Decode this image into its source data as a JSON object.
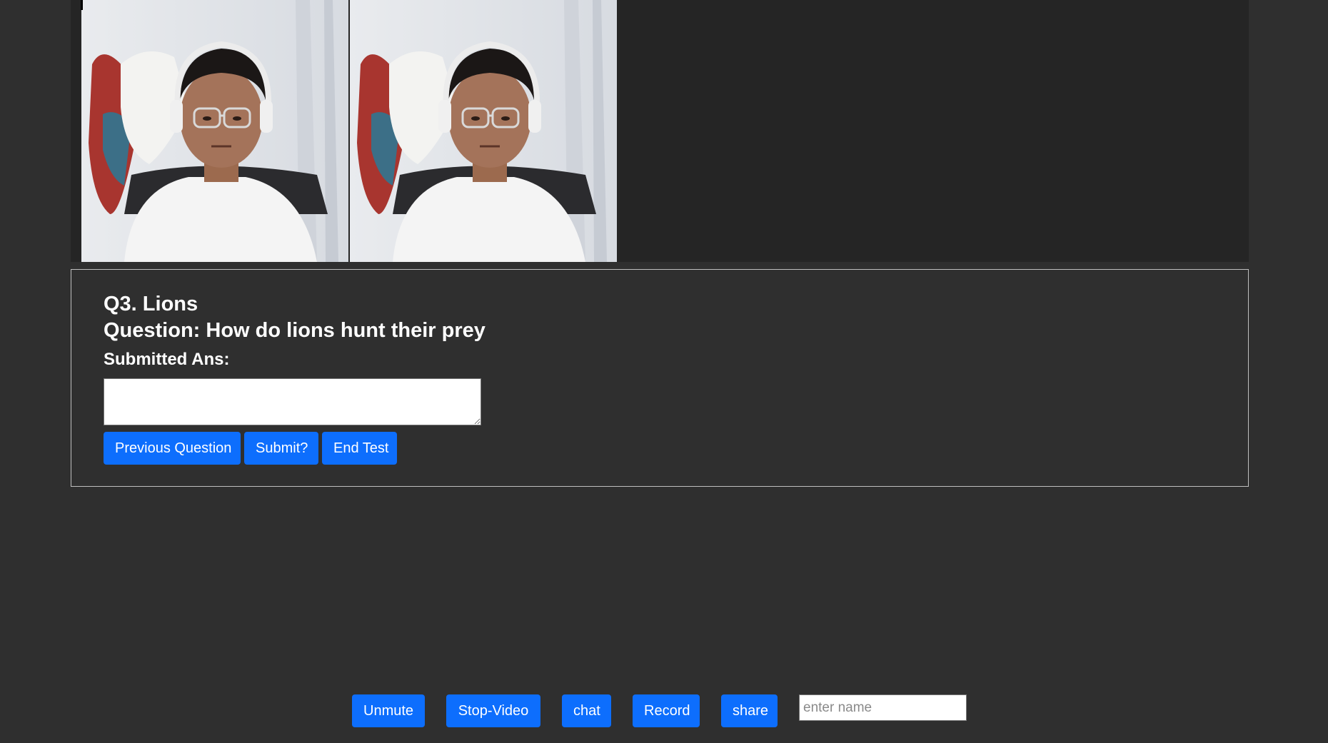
{
  "video": {
    "participants": [
      {
        "icon": "webcam-feed"
      },
      {
        "icon": "webcam-feed"
      }
    ]
  },
  "question": {
    "title": "Q3. Lions",
    "text": "Question: How do lions hunt their prey",
    "answer_label": "Submitted Ans:",
    "answer_value": "",
    "buttons": {
      "previous": "Previous Question",
      "submit": "Submit?",
      "end": "End Test"
    }
  },
  "toolbar": {
    "unmute": "Unmute",
    "stop_video": "Stop-Video",
    "chat": "chat",
    "record": "Record",
    "share": "share",
    "name_placeholder": "enter name"
  },
  "colors": {
    "background": "#2f2f2f",
    "video_area": "#252525",
    "button": "#0d6efd",
    "text": "#ffffff"
  }
}
